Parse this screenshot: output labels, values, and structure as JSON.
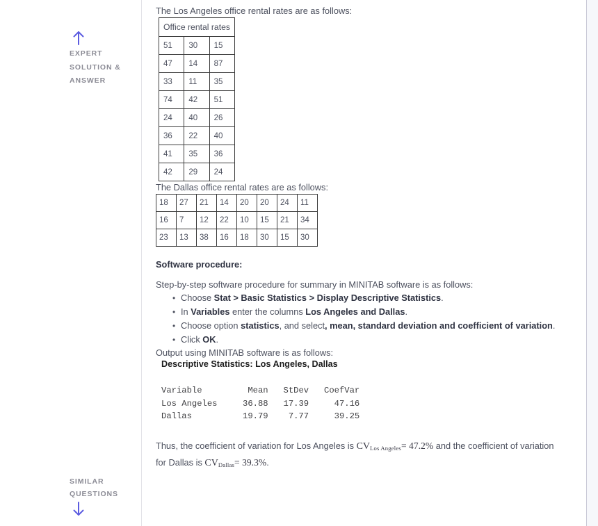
{
  "sidebar": {
    "expert": {
      "icon": "arrow-up-icon",
      "label": "EXPERT SOLUTION & ANSWER",
      "line1": "EXPERT",
      "line2": "SOLUTION &",
      "line3": "ANSWER"
    },
    "similar": {
      "icon": "arrow-down-icon",
      "line1": "SIMILAR",
      "line2": "QUESTIONS",
      "label": "SIMILAR QUESTIONS"
    },
    "accent_color": "#5c5ce0",
    "label_color": "#8b8b95"
  },
  "content": {
    "la_intro": "The Los Angeles office rental rates are as follows:",
    "la_table": {
      "header": "Office rental rates",
      "rows": [
        [
          "51",
          "30",
          "15"
        ],
        [
          "47",
          "14",
          "87"
        ],
        [
          "33",
          "11",
          "35"
        ],
        [
          "74",
          "42",
          "51"
        ],
        [
          "24",
          "40",
          "26"
        ],
        [
          "36",
          "22",
          "40"
        ],
        [
          "41",
          "35",
          "36"
        ],
        [
          "42",
          "29",
          "24"
        ]
      ]
    },
    "dallas_intro": "The Dallas office rental rates are as follows:",
    "dallas_table": {
      "rows": [
        [
          "18",
          "27",
          "21",
          "14",
          "20",
          "20",
          "24",
          "11"
        ],
        [
          "16",
          "7",
          "12",
          "22",
          "10",
          "15",
          "21",
          "34"
        ],
        [
          "23",
          "13",
          "38",
          "16",
          "18",
          "30",
          "15",
          "30"
        ]
      ]
    },
    "software_heading": "Software procedure:",
    "software_intro": "Step-by-step software procedure for summary in MINITAB software is as follows:",
    "steps": [
      {
        "pre": "Choose ",
        "bold": "Stat > Basic Statistics > Display Descriptive Statistics",
        "post": "."
      },
      {
        "pre": "In ",
        "bold": "Variables",
        "mid": " enter the columns ",
        "bold2": "Los Angeles and Dallas",
        "post": "."
      },
      {
        "pre": "Choose option ",
        "bold": "statistics",
        "mid": ", and select",
        "bold2": ", mean, standard deviation and coefficient of variation",
        "post": "."
      },
      {
        "pre": "Click ",
        "bold": "OK",
        "post": "."
      }
    ],
    "output_intro": "Output using MINITAB software is as follows:",
    "minitab": {
      "title": "Descriptive Statistics: Los Angeles, Dallas",
      "columns": [
        "Variable",
        "Mean",
        "StDev",
        "CoefVar"
      ],
      "rows": [
        {
          "variable": "Los Angeles",
          "mean": "36.88",
          "stdev": "17.39",
          "coefvar": "47.16"
        },
        {
          "variable": "Dallas",
          "mean": "19.79",
          "stdev": "7.77",
          "coefvar": "39.25"
        }
      ],
      "text_block": "Variable         Mean   StDev   CoefVar\nLos Angeles     36.88   17.39     47.16\nDallas          19.79    7.77     39.25"
    },
    "conclusion": {
      "part1": "Thus, the coefficient of variation for Los Angeles is ",
      "cv1_symbol": "CV",
      "cv1_sub": "Los Angeles",
      "cv1_value": "= 47.2%",
      "part2": " and the coefficient of variation for Dallas is ",
      "cv2_symbol": "CV",
      "cv2_sub": "Dallas",
      "cv2_value": "= 39.3%",
      "part3": "."
    }
  }
}
